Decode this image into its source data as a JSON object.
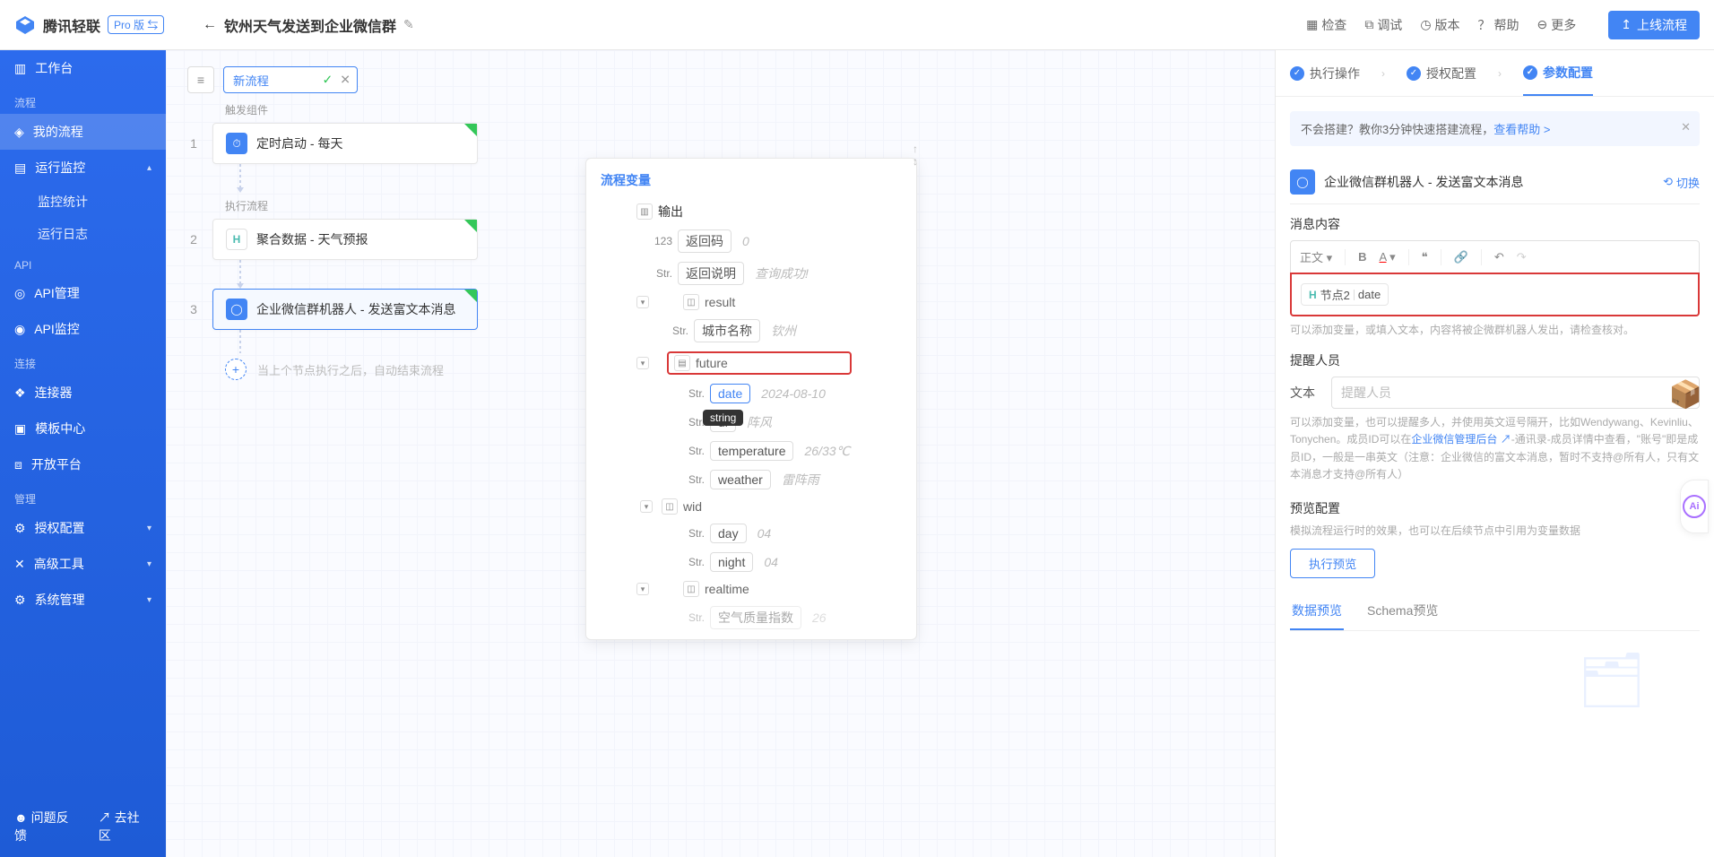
{
  "header": {
    "brand": "腾讯轻联",
    "pro_badge": "Pro 版 ⇆",
    "title": "钦州天气发送到企业微信群",
    "actions": {
      "inspect": "检查",
      "debug": "调试",
      "version": "版本",
      "help": "帮助",
      "more": "更多",
      "publish": "上线流程"
    }
  },
  "sidebar": {
    "workspace": "工作台",
    "section_flow": "流程",
    "my_flows": "我的流程",
    "monitor": "运行监控",
    "monitor_stats": "监控统计",
    "monitor_logs": "运行日志",
    "section_api": "API",
    "api_mgmt": "API管理",
    "api_monitor": "API监控",
    "section_conn": "连接",
    "connectors": "连接器",
    "templates": "模板中心",
    "open_platform": "开放平台",
    "section_mgmt": "管理",
    "auth_config": "授权配置",
    "adv_tools": "高级工具",
    "sys_mgmt": "系统管理",
    "feedback": "问题反馈",
    "community": "去社区"
  },
  "canvas": {
    "flow_name": "新流程",
    "trigger_label": "触发组件",
    "node1": "定时启动 - 每天",
    "exec_label": "执行流程",
    "node2": "聚合数据 - 天气预报",
    "node3": "企业微信群机器人 - 发送富文本消息",
    "end_text": "当上个节点执行之后，自动结束流程"
  },
  "var_panel": {
    "title": "流程变量",
    "tooltip": "string",
    "rows": {
      "return_code_lbl": "返回码",
      "return_code_val": "0",
      "return_msg_lbl": "返回说明",
      "return_msg_val": "查询成功!",
      "result": "result",
      "city_lbl": "城市名称",
      "city_val": "钦州",
      "future": "future",
      "date_lbl": "date",
      "date_val": "2024-08-10",
      "direct_lbl": "di",
      "direct_val": "阵风",
      "temp_lbl": "temperature",
      "temp_val": "26/33℃",
      "weather_lbl": "weather",
      "weather_val": "雷阵雨",
      "wid": "wid",
      "day_lbl": "day",
      "day_val": "04",
      "night_lbl": "night",
      "night_val": "04",
      "realtime": "realtime",
      "aqi_lbl": "空气质量指数",
      "aqi_val": "26"
    }
  },
  "config": {
    "tabs": {
      "exec": "执行操作",
      "auth": "授权配置",
      "params": "参数配置"
    },
    "banner_pre": "不会搭建？教你3分钟快速搭建流程，",
    "banner_link": "查看帮助 >",
    "node_title": "企业微信群机器人 - 发送富文本消息",
    "switch": "切换",
    "msg_content_label": "消息内容",
    "rte_dropdown": "正文",
    "chip_node": "节点2",
    "chip_field": "date",
    "msg_hint": "可以添加变量，或填入文本，内容将被企微群机器人发出，请检查核对。",
    "mention_label": "提醒人员",
    "mention_text_lbl": "文本",
    "mention_placeholder": "提醒人员",
    "mention_hint_a": "可以添加变量，也可以提醒多人，并使用英文逗号隔开，比如Wendywang、Kevinliu、Tonychen。成员ID可以在",
    "mention_hint_link": "企业微信管理后台",
    "mention_hint_b": "-通讯录-成员详情中查看，\"账号\"即是成员ID，一般是一串英文（注意：企业微信的富文本消息，暂时不支持@所有人，只有文本消息才支持@所有人）",
    "preview_label": "预览配置",
    "preview_hint": "模拟流程运行时的效果，也可以在后续节点中引用为变量数据",
    "preview_btn": "执行预览",
    "sub_tabs": {
      "data": "数据预览",
      "schema": "Schema预览"
    }
  }
}
